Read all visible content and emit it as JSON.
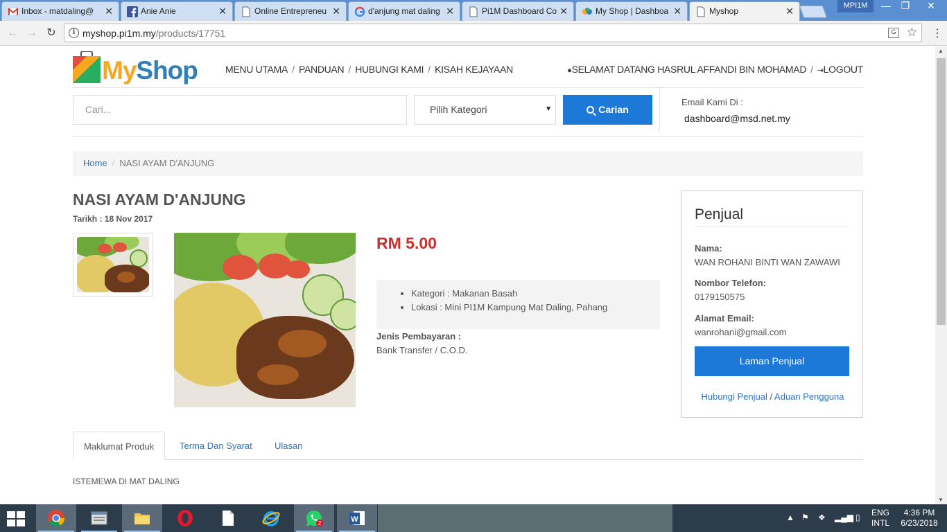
{
  "browser": {
    "tabs": [
      {
        "title": "Inbox - matdaling@",
        "icon": "gmail-icon"
      },
      {
        "title": "Anie Anie",
        "icon": "facebook-icon"
      },
      {
        "title": "Online Entrepreneu",
        "icon": "page-icon"
      },
      {
        "title": "d'anjung mat daling",
        "icon": "google-icon"
      },
      {
        "title": "Pi1M Dashboard Co",
        "icon": "page-icon"
      },
      {
        "title": "My Shop | Dashboa",
        "icon": "myshop-icon"
      },
      {
        "title": "Myshop",
        "icon": "page-icon"
      }
    ],
    "profile": "MPI1M",
    "url_host": "myshop.pi1m.my",
    "url_path": "/products/17751"
  },
  "header": {
    "logo_my": "My",
    "logo_shop": "Shop",
    "nav": [
      "MENU UTAMA",
      "PANDUAN",
      "HUBUNGI KAMI",
      "KISAH KEJAYAAN"
    ],
    "welcome": "SELAMAT DATANG HASRUL AFFANDI BIN MOHAMAD",
    "logout": "LOGOUT",
    "search_placeholder": "Cari...",
    "category": "Pilih Kategori",
    "search_button": "Carian",
    "email_label": "Email Kami Di :",
    "email_value": "dashboard@msd.net.my"
  },
  "breadcrumb": {
    "home": "Home",
    "current": "NASI AYAM D'ANJUNG"
  },
  "product": {
    "title": "NASI AYAM D'ANJUNG",
    "date": "Tarikh : 18 Nov 2017",
    "price": "RM 5.00",
    "kategori": "Kategori : Makanan Basah",
    "lokasi": "Lokasi : Mini PI1M Kampung Mat Daling, Pahang",
    "payment_label": "Jenis Pembayaran :",
    "payment_value": "Bank Transfer / C.O.D."
  },
  "seller": {
    "heading": "Penjual",
    "name_label": "Nama:",
    "name": "WAN ROHANI BINTI WAN ZAWAWI",
    "phone_label": "Nombor Telefon:",
    "phone": "0179150575",
    "email_label": "Alamat Email:",
    "email": "wanrohani@gmail.com",
    "button": "Laman Penjual",
    "contact_link": "Hubungi Penjual",
    "link_sep": "/",
    "report_link": "Aduan Pengguna"
  },
  "tabs": [
    "Maklumat Produk",
    "Terma Dan Syarat",
    "Ulasan"
  ],
  "description": "ISTEMEWA DI MAT DALING",
  "taskbar": {
    "whatsapp_badge": "2",
    "lang1": "ENG",
    "lang2": "INTL",
    "time": "4:36 PM",
    "date": "6/23/2018"
  },
  "colors": {
    "accent": "#1d79d8",
    "price": "#c9302c",
    "link": "#2b72c2"
  }
}
